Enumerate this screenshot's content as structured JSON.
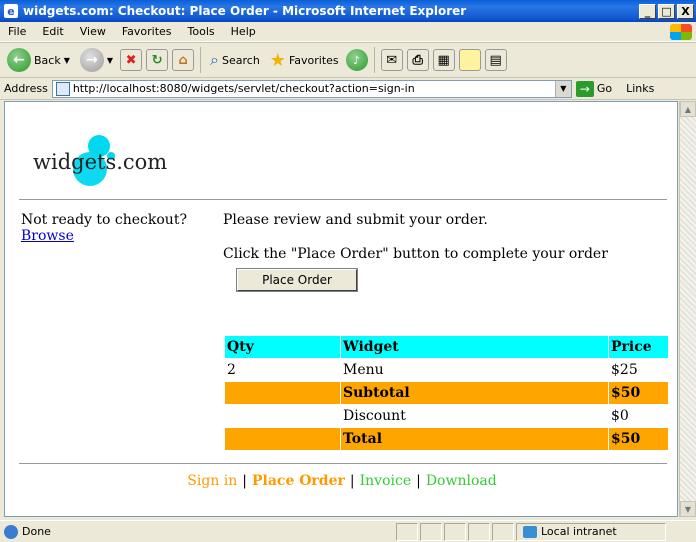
{
  "window": {
    "title": "widgets.com: Checkout: Place Order - Microsoft Internet Explorer",
    "controls": [
      "_",
      "□",
      "X"
    ]
  },
  "menu": [
    "File",
    "Edit",
    "View",
    "Favorites",
    "Tools",
    "Help"
  ],
  "toolbar": {
    "back": "Back",
    "search": "Search",
    "favorites": "Favorites"
  },
  "address": {
    "label": "Address",
    "url": "http://localhost:8080/widgets/servlet/checkout?action=sign-in",
    "go": "Go",
    "links": "Links"
  },
  "logo": {
    "text": "widgets.com"
  },
  "sidebar": {
    "text": "Not ready to checkout?",
    "link": "Browse"
  },
  "main": {
    "review_text": "Please review and submit your order.",
    "instruction": "Click the \"Place Order\" button to complete your order",
    "place_order_button": "Place Order"
  },
  "order_table": {
    "headers": [
      "Qty",
      "Widget",
      "Price"
    ],
    "item": {
      "qty": "2",
      "name": "Menu",
      "price": "$25"
    },
    "subtotal": {
      "label": "Subtotal",
      "value": "$50"
    },
    "discount": {
      "label": "Discount",
      "value": "$0"
    },
    "total": {
      "label": "Total",
      "value": "$50"
    }
  },
  "footer": {
    "sign_in": "Sign in",
    "place_order": "Place Order",
    "invoice": "Invoice",
    "download": "Download",
    "separator": "|"
  },
  "status": {
    "text": "Done",
    "zone": "Local intranet"
  },
  "colors": {
    "header_row": "#00ffff",
    "subtotal_row": "#ffa500",
    "link": "#0000cc",
    "footer_orange": "#ff9900",
    "footer_green": "#33cc33"
  }
}
